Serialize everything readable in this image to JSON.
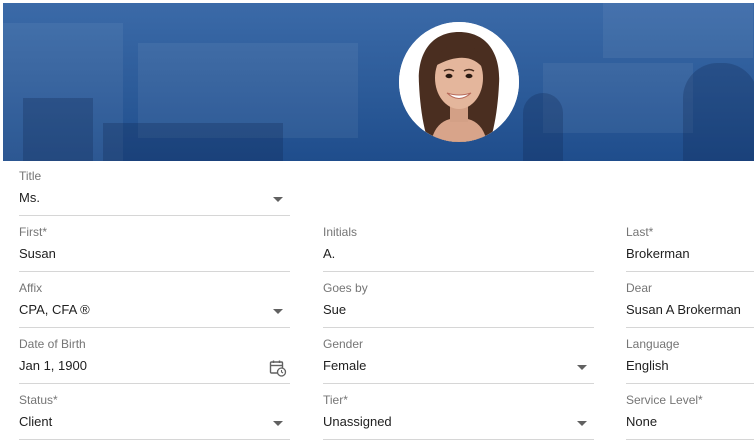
{
  "profile": {
    "avatar_icon": "person-photo-icon",
    "banner_color": "#2c5b99"
  },
  "form": {
    "title": {
      "label": "Title",
      "value": "Ms."
    },
    "first": {
      "label": "First*",
      "value": "Susan"
    },
    "initials": {
      "label": "Initials",
      "value": "A."
    },
    "last": {
      "label": "Last*",
      "value": "Brokerman"
    },
    "affix": {
      "label": "Affix",
      "value": "CPA, CFA ®"
    },
    "goes_by": {
      "label": "Goes by",
      "value": "Sue"
    },
    "dear": {
      "label": "Dear",
      "value": "Susan A Brokerman"
    },
    "dob": {
      "label": "Date of Birth",
      "value": "Jan 1, 1900",
      "icon": "calendar-clock-icon"
    },
    "gender": {
      "label": "Gender",
      "value": "Female"
    },
    "language": {
      "label": "Language",
      "value": "English"
    },
    "status": {
      "label": "Status*",
      "value": "Client"
    },
    "tier": {
      "label": "Tier*",
      "value": "Unassigned"
    },
    "service_level": {
      "label": "Service Level*",
      "value": "None"
    }
  }
}
